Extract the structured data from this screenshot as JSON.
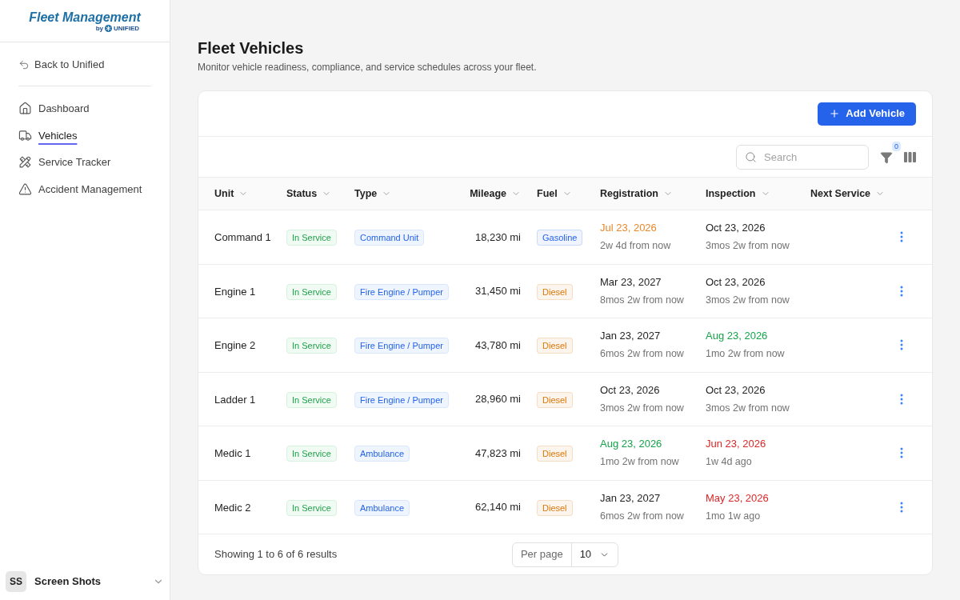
{
  "sidebar": {
    "logo": {
      "title": "Fleet Management",
      "by": "by",
      "brand": "UNIFIED"
    },
    "back_link": "Back to Unified",
    "items": [
      {
        "label": "Dashboard",
        "selected": false
      },
      {
        "label": "Vehicles",
        "selected": true
      },
      {
        "label": "Service Tracker",
        "selected": false
      },
      {
        "label": "Accident Management",
        "selected": false
      }
    ],
    "workspace": {
      "initials": "SS",
      "name": "Screen Shots"
    }
  },
  "page": {
    "title": "Fleet Vehicles",
    "subtitle": "Monitor vehicle readiness, compliance, and service schedules across your fleet."
  },
  "toolbar": {
    "add_button": "Add Vehicle",
    "search": {
      "placeholder": "Search"
    },
    "filter_count": "0"
  },
  "table": {
    "columns": [
      "Unit",
      "Status",
      "Type",
      "Mileage",
      "Fuel",
      "Registration",
      "Inspection",
      "Next Service"
    ],
    "rows": [
      {
        "unit": "Command 1",
        "status": "In Service",
        "type": "Command Unit",
        "mileage": "18,230 mi",
        "fuel": {
          "label": "Gasoline",
          "color": "#2563eb"
        },
        "registration": {
          "date": "Jul 23, 2026",
          "relative": "2w 4d from now",
          "color": "#e8892b"
        },
        "inspection": {
          "date": "Oct 23, 2026",
          "relative": "3mos 2w from now",
          "color": "#1f1f1f"
        }
      },
      {
        "unit": "Engine 1",
        "status": "In Service",
        "type": "Fire Engine / Pumper",
        "mileage": "31,450 mi",
        "fuel": {
          "label": "Diesel",
          "color": "#d97706"
        },
        "registration": {
          "date": "Mar 23, 2027",
          "relative": "8mos 2w from now",
          "color": "#1f1f1f"
        },
        "inspection": {
          "date": "Oct 23, 2026",
          "relative": "3mos 2w from now",
          "color": "#1f1f1f"
        }
      },
      {
        "unit": "Engine 2",
        "status": "In Service",
        "type": "Fire Engine / Pumper",
        "mileage": "43,780 mi",
        "fuel": {
          "label": "Diesel",
          "color": "#d97706"
        },
        "registration": {
          "date": "Jan 23, 2027",
          "relative": "6mos 2w from now",
          "color": "#1f1f1f"
        },
        "inspection": {
          "date": "Aug 23, 2026",
          "relative": "1mo 2w from now",
          "color": "#16a34a"
        }
      },
      {
        "unit": "Ladder 1",
        "status": "In Service",
        "type": "Fire Engine / Pumper",
        "mileage": "28,960 mi",
        "fuel": {
          "label": "Diesel",
          "color": "#d97706"
        },
        "registration": {
          "date": "Oct 23, 2026",
          "relative": "3mos 2w from now",
          "color": "#1f1f1f"
        },
        "inspection": {
          "date": "Oct 23, 2026",
          "relative": "3mos 2w from now",
          "color": "#1f1f1f"
        }
      },
      {
        "unit": "Medic 1",
        "status": "In Service",
        "type": "Ambulance",
        "mileage": "47,823 mi",
        "fuel": {
          "label": "Diesel",
          "color": "#d97706"
        },
        "registration": {
          "date": "Aug 23, 2026",
          "relative": "1mo 2w from now",
          "color": "#16a34a"
        },
        "inspection": {
          "date": "Jun 23, 2026",
          "relative": "1w 4d ago",
          "color": "#dc2626"
        }
      },
      {
        "unit": "Medic 2",
        "status": "In Service",
        "type": "Ambulance",
        "mileage": "62,140 mi",
        "fuel": {
          "label": "Diesel",
          "color": "#d97706"
        },
        "registration": {
          "date": "Jan 23, 2027",
          "relative": "6mos 2w from now",
          "color": "#1f1f1f"
        },
        "inspection": {
          "date": "May 23, 2026",
          "relative": "1mo 1w ago",
          "color": "#dc2626"
        }
      }
    ]
  },
  "footer": {
    "summary": "Showing 1 to 6 of 6 results",
    "per_page": {
      "label": "Per page",
      "value": "10"
    }
  }
}
